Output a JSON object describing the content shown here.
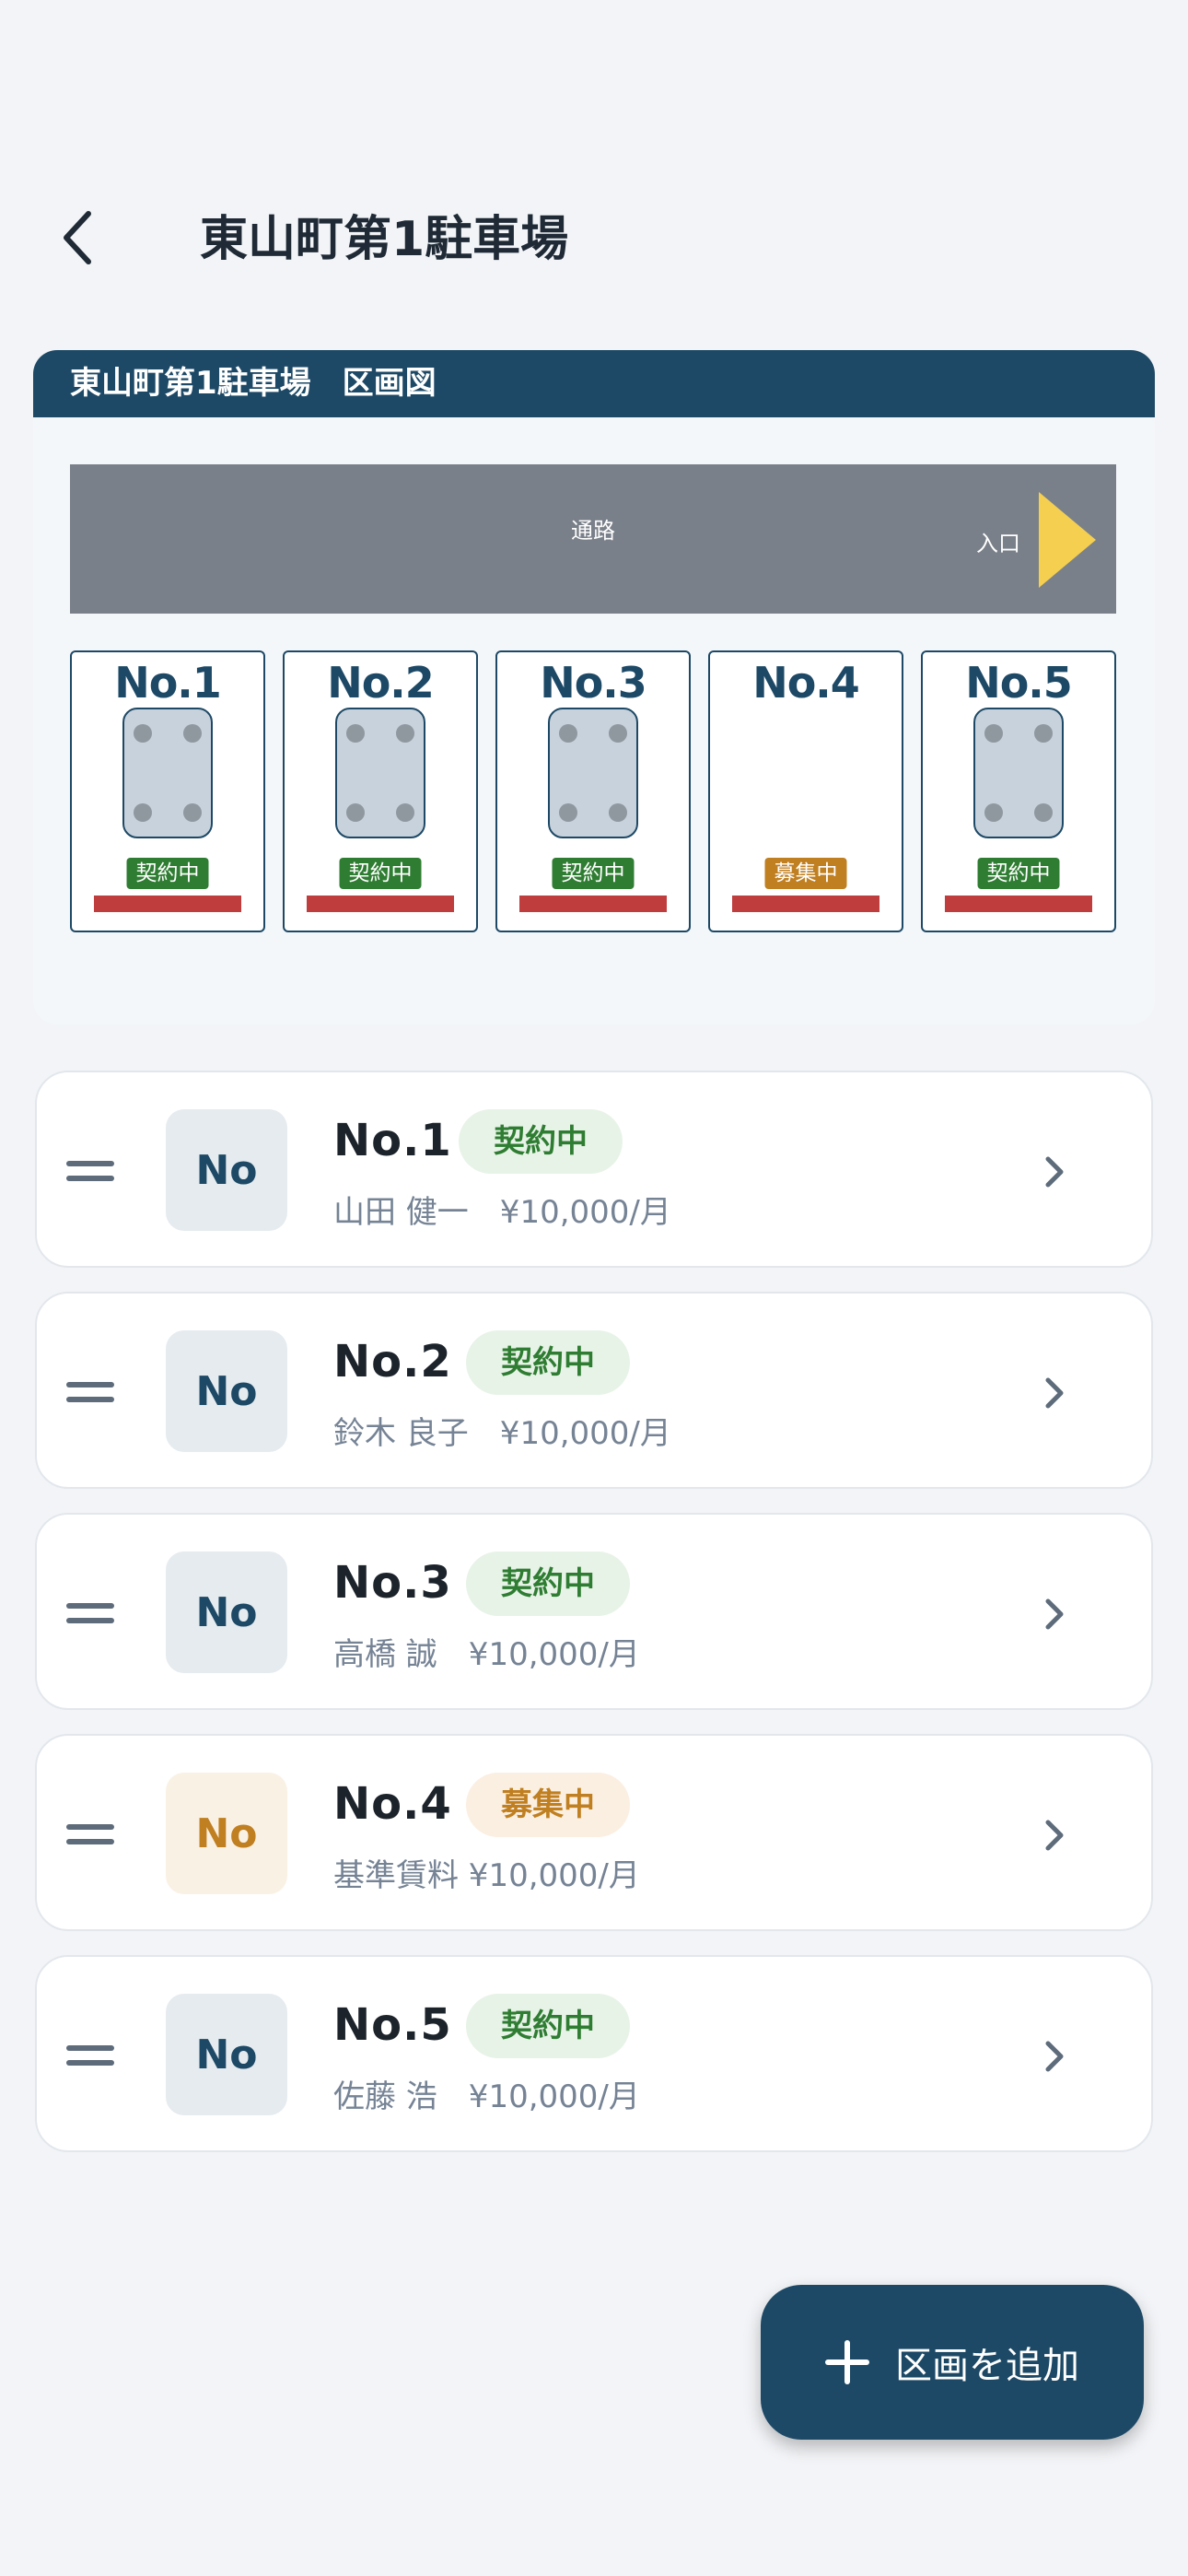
{
  "header": {
    "title": "東山町第1駐車場"
  },
  "map": {
    "title": "東山町第1駐車場　区画図",
    "aisle_label": "通路",
    "entry_label": "入口",
    "slots": [
      {
        "no": "No.1",
        "status": "契約中",
        "occupied": true
      },
      {
        "no": "No.2",
        "status": "契約中",
        "occupied": true
      },
      {
        "no": "No.3",
        "status": "契約中",
        "occupied": true
      },
      {
        "no": "No.4",
        "status": "募集中",
        "occupied": false
      },
      {
        "no": "No.5",
        "status": "契約中",
        "occupied": true
      }
    ]
  },
  "list": [
    {
      "thumb": "No",
      "title": "No.1",
      "status": "契約中",
      "detail": "山田 健一　¥10,000/月"
    },
    {
      "thumb": "No",
      "title": "No.2",
      "status": "契約中",
      "detail": "鈴木 良子　¥10,000/月"
    },
    {
      "thumb": "No",
      "title": "No.3",
      "status": "契約中",
      "detail": "高橋 誠　¥10,000/月"
    },
    {
      "thumb": "No",
      "title": "No.4",
      "status": "募集中",
      "detail": "基準賃料 ¥10,000/月"
    },
    {
      "thumb": "No",
      "title": "No.5",
      "status": "契約中",
      "detail": "佐藤 浩　¥10,000/月"
    }
  ],
  "fab": {
    "label": "区画を追加"
  },
  "colors": {
    "primary": "#1d4966",
    "contracted": "#2f7d32",
    "vacant": "#c07f20",
    "bar": "#c03d3d"
  }
}
